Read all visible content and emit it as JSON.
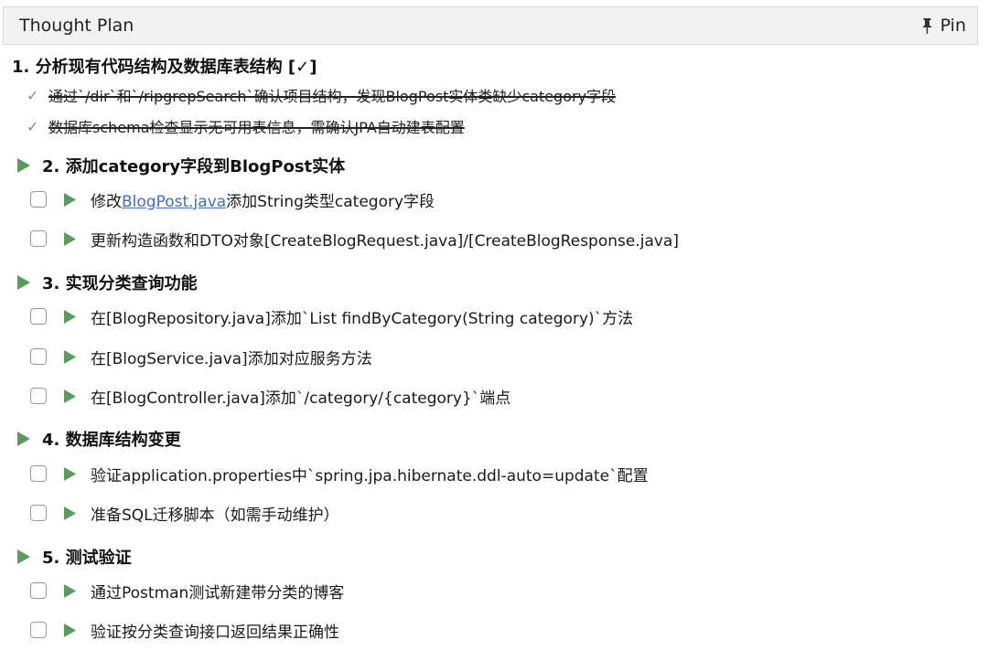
{
  "header": {
    "title": "Thought Plan",
    "pin_label": "Pin",
    "pin_icon": "pin-icon"
  },
  "sections": [
    {
      "title": "1. 分析现有代码结构及数据库表结构 [✓]",
      "status": "done",
      "items": [
        {
          "check": "✓",
          "text": "通过`/dir`和`/ripgrepSearch`确认项目结构，发现BlogPost实体类缺少category字段"
        },
        {
          "check": "✓",
          "text": "数据库schema检查显示无可用表信息，需确认JPA自动建表配置"
        }
      ]
    },
    {
      "title": "2. 添加category字段到BlogPost实体",
      "status": "pending",
      "items": [
        {
          "prefix": "修改",
          "link": "BlogPost.java",
          "suffix": "添加String类型category字段"
        },
        {
          "text": "更新构造函数和DTO对象[CreateBlogRequest.java]/[CreateBlogResponse.java]"
        }
      ]
    },
    {
      "title": "3. 实现分类查询功能",
      "status": "pending",
      "items": [
        {
          "text": "在[BlogRepository.java]添加`List findByCategory(String category)`方法"
        },
        {
          "text": "在[BlogService.java]添加对应服务方法"
        },
        {
          "text": "在[BlogController.java]添加`/category/{category}`端点"
        }
      ]
    },
    {
      "title": "4. 数据库结构变更",
      "status": "pending",
      "items": [
        {
          "text": "验证application.properties中`spring.jpa.hibernate.ddl-auto=update`配置"
        },
        {
          "text": "准备SQL迁移脚本（如需手动维护）"
        }
      ]
    },
    {
      "title": "5. 测试验证",
      "status": "pending",
      "items": [
        {
          "text": "通过Postman测试新建带分类的博客"
        },
        {
          "text": "验证按分类查询接口返回结果正确性"
        }
      ]
    }
  ],
  "colors": {
    "play_green": "#5a9a5a",
    "link_blue": "#3d6fc7",
    "header_bg": "#f2f2f2"
  }
}
